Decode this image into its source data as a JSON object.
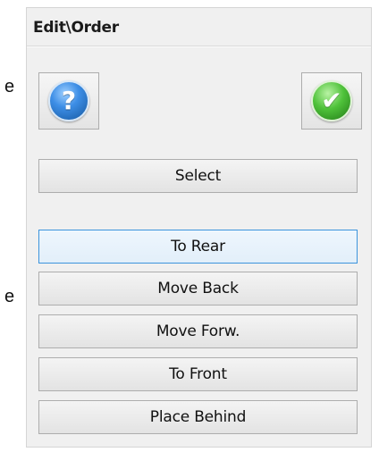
{
  "background_fragments": [
    "e",
    "e"
  ],
  "panel": {
    "title": "Edit\\Order"
  },
  "icons": {
    "help": {
      "name": "help-icon",
      "glyph": "?",
      "color": "#2f80d8"
    },
    "ok": {
      "name": "checkmark-icon",
      "glyph": "✔",
      "color": "#3fae2a"
    }
  },
  "buttons": {
    "select": "Select",
    "to_rear": "To Rear",
    "move_back": "Move Back",
    "move_forw": "Move Forw.",
    "to_front": "To Front",
    "place_behind": "Place Behind"
  },
  "focused_button": "to_rear"
}
